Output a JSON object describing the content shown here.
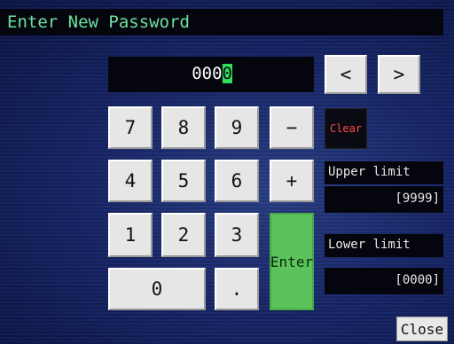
{
  "title": "Enter New Password",
  "display": {
    "value_prefix": "000",
    "cursor_char": "0"
  },
  "keypad": {
    "k7": "7",
    "k8": "8",
    "k9": "9",
    "minus": "−",
    "k4": "4",
    "k5": "5",
    "k6": "6",
    "plus": "+",
    "k1": "1",
    "k2": "2",
    "k3": "3",
    "k0": "0",
    "dot": ".",
    "enter": "Enter"
  },
  "nav": {
    "prev": "<",
    "next": ">"
  },
  "clear": "Clear",
  "upper_limit": {
    "label": "Upper limit",
    "value": "[9999]"
  },
  "lower_limit": {
    "label": "Lower limit",
    "value": "[0000]"
  },
  "close": "Close",
  "colors": {
    "title_text": "#6de0a0",
    "cursor_bg": "#2ee05a",
    "enter_bg": "#5cc25c",
    "clear_text": "#ff4a4a"
  }
}
